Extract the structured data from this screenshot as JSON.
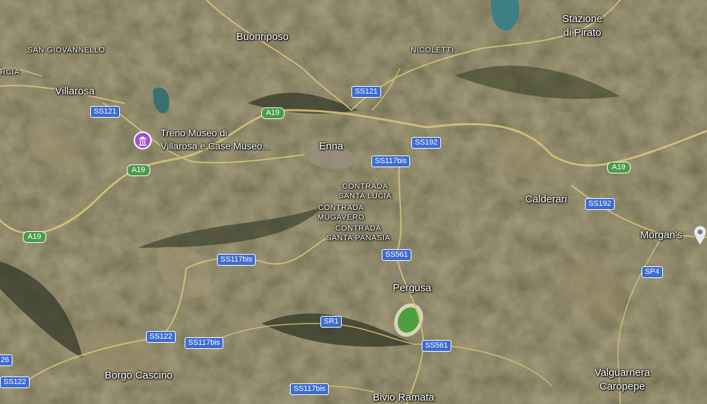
{
  "colors": {
    "route_shield_blue": "#3d6bd1",
    "motorway_shield_green": "#4a9b4a",
    "poi_museum_purple": "#a04fd0",
    "location_pin_grey": "#e8e8e8"
  },
  "places": {
    "buonriposo": "Buonriposo",
    "stazione_line1": "Stazione",
    "stazione_line2": "di Pirato",
    "san_giovannello": "SAN GIOVANNELLO",
    "nicoletti": "NICOLETTI",
    "rcia": "RCIA",
    "villarosa": "Villarosa",
    "enna": "Enna",
    "contrada_santa_lucia_1": "CONTRADA",
    "contrada_santa_lucia_2": "SANTA LUCIA",
    "contrada_mugavero_1": "CONTRADA",
    "contrada_mugavero_2": "MUGAVERO",
    "contrada_santa_panasia_1": "CONTRADA",
    "contrada_santa_panasia_2": "SANTA PANASIA",
    "calderari": "Calderari",
    "morgans": "Morgan's",
    "pergusa": "Pergusa",
    "borgo_cascino": "Borgo Cascino",
    "valguarnera_1": "Valguarnera",
    "valguarnera_2": "Caropepe",
    "bivio_ramata": "Bivio Ramata"
  },
  "poi": {
    "museum_line1": "Treno Museo di",
    "museum_line2": "Villarosa e Case Museo..."
  },
  "roads": {
    "ss121_a": "SS121",
    "ss121_b": "SS121",
    "a19_a": "A19",
    "a19_b": "A19",
    "a19_c": "A19",
    "a19_d": "A19",
    "ss192_a": "SS192",
    "ss192_b": "SS192",
    "ss117bis_a": "SS117bis",
    "ss117bis_b": "SS117bis",
    "ss117bis_c": "SS117bis",
    "ss117bis_d": "SS117bis",
    "ss561_a": "SS561",
    "ss561_b": "SS561",
    "sp4": "SP4",
    "sr1": "SR1",
    "ss122_a": "SS122",
    "ss122_b": "SS122",
    "route_26": "26"
  }
}
